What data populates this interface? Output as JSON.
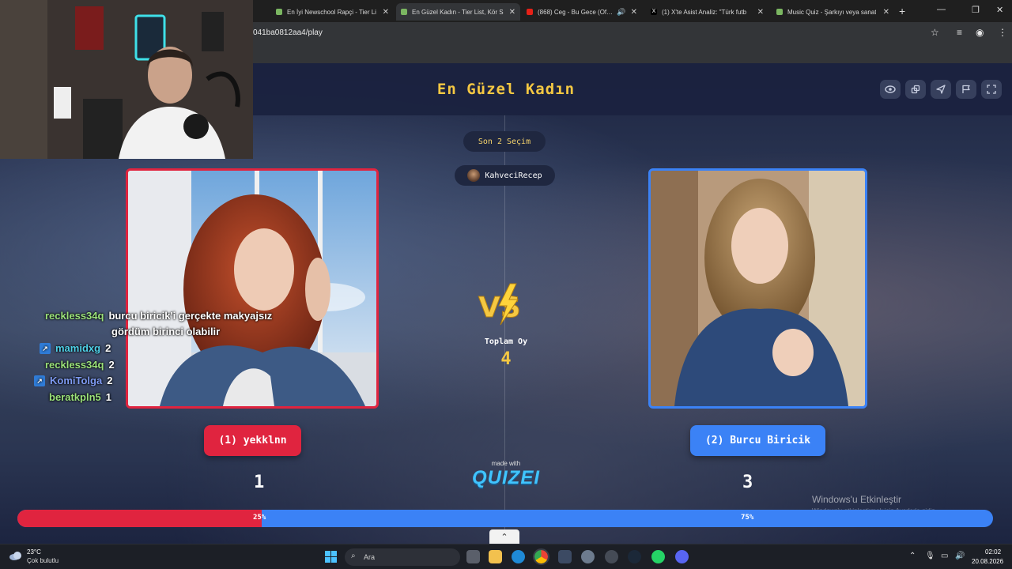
{
  "browser": {
    "tabs": [
      {
        "title": "En İyi Newschool Rapçi - Tier Li",
        "active": false
      },
      {
        "title": "En Güzel Kadın - Tier List, Kör S",
        "active": true
      },
      {
        "title": "(868) Ceg - Bu Gece (Official",
        "active": false
      },
      {
        "title": "(1) X'te Asist Analiz: \"Türk futb",
        "active": false
      },
      {
        "title": "Music Quiz - Şarkıyı veya sanat",
        "active": false
      }
    ],
    "url": "041ba0812aa4/play"
  },
  "quiz": {
    "title": "En Güzel Kadın",
    "round_label": "Son 2 Seçim",
    "host_name": "KahveciRecep",
    "total_label": "Toplam Oy",
    "total_votes": "4",
    "left": {
      "button": "(1) yekklnn",
      "score": "1",
      "pct": "25%",
      "fraction": 0.25
    },
    "right": {
      "button": "(2) Burcu Biricik",
      "score": "3",
      "pct": "75%"
    },
    "made_with": "made with",
    "brand": "QUIZEI"
  },
  "chat": {
    "messages": [
      {
        "user": "reckless34q",
        "text": "burcu biricik'i gerçekte makyajsız",
        "text2": "gördüm birinci olabilir"
      },
      {
        "user": "mamidxg",
        "text": "2"
      },
      {
        "user": "reckless34q",
        "text": "2"
      },
      {
        "user": "KomiTolga",
        "text": "2"
      },
      {
        "user": "beratkpln5",
        "text": "1"
      }
    ]
  },
  "watermark": {
    "line1": "Windows'u Etkinleştir",
    "line2": "Windows'u etkinleştirmek için Ayarlar'a gidin."
  },
  "taskbar": {
    "temp": "23°C",
    "weather": "Çok bulutlu",
    "search_placeholder": "Ara",
    "time": "02:02",
    "date": "20.08.2026"
  },
  "colors": {
    "accent_left": "#e0243f",
    "accent_right": "#3b82f6",
    "title": "#f5c842"
  }
}
